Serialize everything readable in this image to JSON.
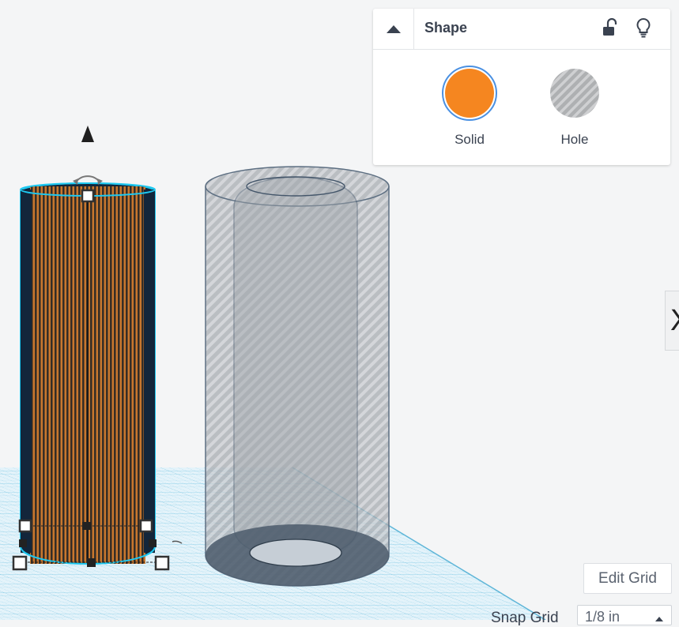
{
  "inspector": {
    "title": "Shape",
    "collapse_icon": "caret-up-icon",
    "lock_icon": "unlock-icon",
    "light_icon": "lightbulb-icon",
    "options": [
      {
        "label": "Solid",
        "selected": true,
        "color": "#f58620"
      },
      {
        "label": "Hole",
        "selected": false,
        "color": "#b0b0b0"
      }
    ]
  },
  "side_tab": {
    "glyph": "X"
  },
  "grid": {
    "edit_label": "Edit Grid",
    "snap_label": "Snap Grid",
    "snap_value": "1/8 in"
  },
  "colors": {
    "selection": "#1ec8f0",
    "solid_orange": "#f58620",
    "cylinder_dark": "#13263b",
    "workplane_line": "#8ccfe8",
    "hole_gray": "#9ea4aa",
    "panel_border": "#e2e4e7"
  }
}
